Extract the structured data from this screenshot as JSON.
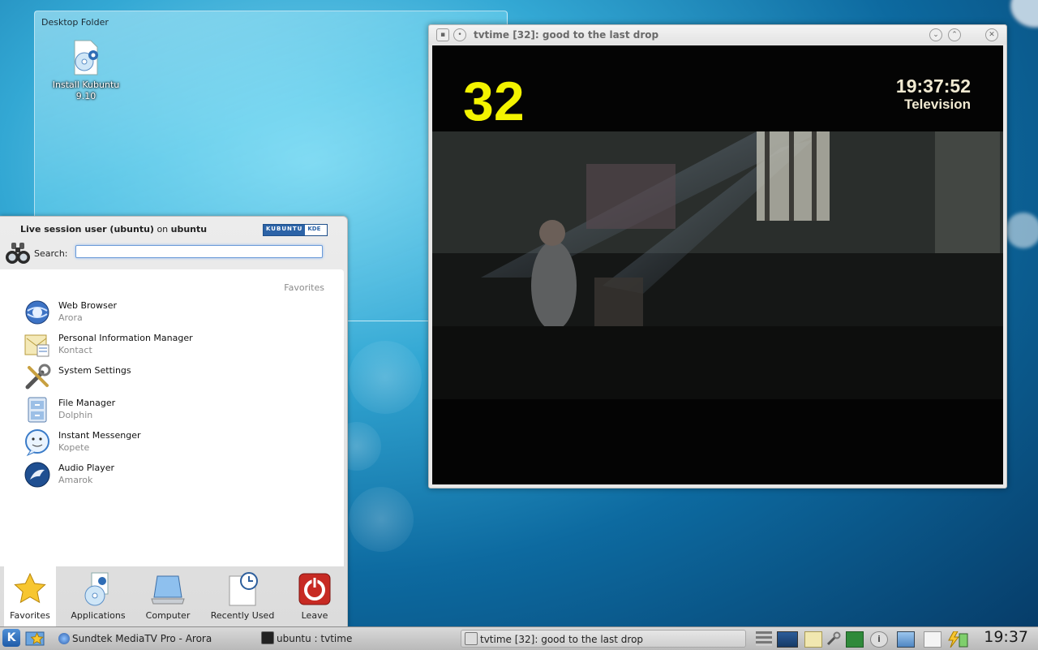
{
  "desktop": {
    "folder_title": "Desktop Folder",
    "icons": [
      {
        "label": "Install Kubuntu\n9.10",
        "icon": "install-cd-icon"
      }
    ]
  },
  "kickoff": {
    "session_user": "Live session user (ubuntu)",
    "session_on": "on",
    "session_host": "ubuntu",
    "logo_left": "KUBUNTU",
    "logo_right": "KDE",
    "search_label": "Search:",
    "search_value": "",
    "favorites_heading": "Favorites",
    "favorites": [
      {
        "name": "Web Browser",
        "app": "Arora",
        "icon": "globe-icon"
      },
      {
        "name": "Personal Information Manager",
        "app": "Kontact",
        "icon": "kontact-icon"
      },
      {
        "name": "System Settings",
        "app": "",
        "icon": "tools-icon"
      },
      {
        "name": "File Manager",
        "app": "Dolphin",
        "icon": "file-manager-icon"
      },
      {
        "name": "Instant Messenger",
        "app": "Kopete",
        "icon": "chat-icon"
      },
      {
        "name": "Audio Player",
        "app": "Amarok",
        "icon": "amarok-icon"
      }
    ],
    "tabs": [
      {
        "label": "Favorites",
        "icon": "star-icon",
        "active": true
      },
      {
        "label": "Applications",
        "icon": "applications-icon"
      },
      {
        "label": "Computer",
        "icon": "computer-icon"
      },
      {
        "label": "Recently Used",
        "icon": "clock-document-icon"
      },
      {
        "label": "Leave",
        "icon": "power-icon"
      }
    ]
  },
  "tvtime": {
    "title": "tvtime [32]: good to the last drop",
    "channel": "32",
    "time": "19:37:52",
    "source": "Television"
  },
  "taskbar": {
    "tasks": [
      {
        "label": "Sundtek MediaTV Pro - Arora",
        "icon": "globe-icon"
      },
      {
        "label": "ubuntu : tvtime",
        "icon": "terminal-icon"
      },
      {
        "label": "tvtime [32]: good to the last drop",
        "icon": "tv-icon",
        "active": true
      }
    ],
    "clock": "19:37"
  },
  "colors": {
    "osd_channel": "#f3f300",
    "osd_text": "#f1ead2",
    "search_focus": "#6b9bd8"
  }
}
